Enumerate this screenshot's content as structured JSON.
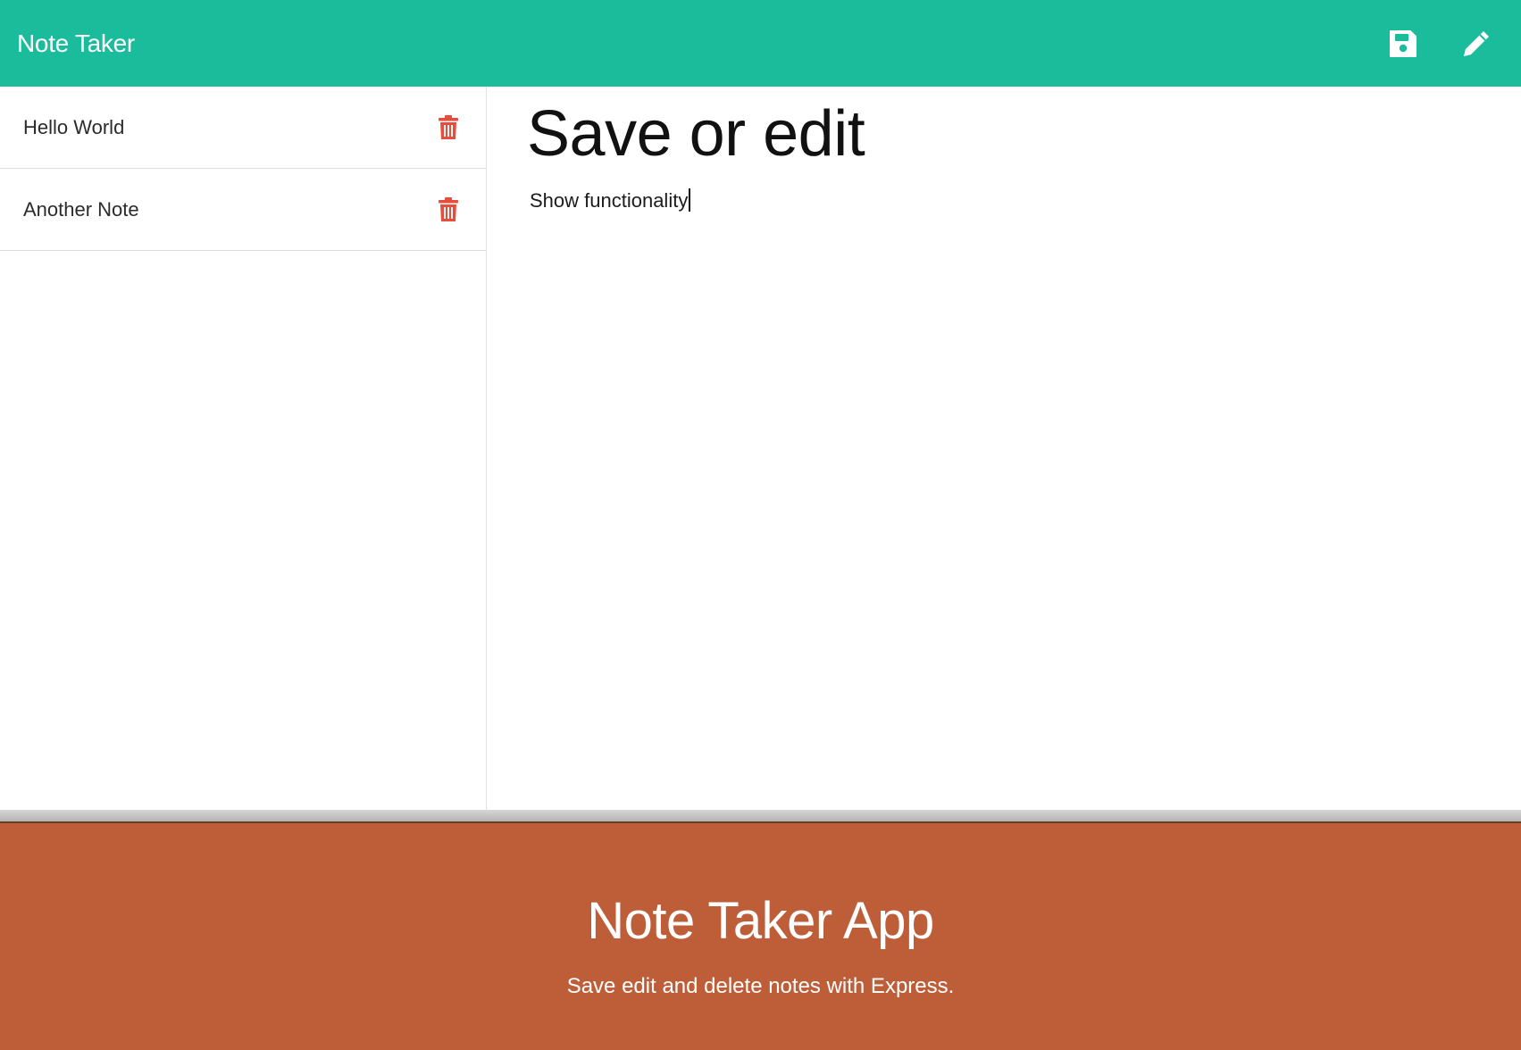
{
  "navbar": {
    "brand": "Note Taker",
    "save_icon": "floppy-disk-icon",
    "new_icon": "pencil-icon",
    "bg_color": "#1abc9c"
  },
  "sidebar": {
    "notes": [
      {
        "title": "Hello World",
        "delete_icon": "trash-icon"
      },
      {
        "title": "Another Note",
        "delete_icon": "trash-icon"
      }
    ]
  },
  "editor": {
    "title": "Save or edit",
    "body": "Show functionality"
  },
  "banner": {
    "title": "Note Taker App",
    "subtitle": "Save edit and delete notes with Express.",
    "bg_color": "#be5e39"
  },
  "colors": {
    "accent": "#1abc9c",
    "danger": "#e74c3c",
    "banner": "#be5e39"
  }
}
